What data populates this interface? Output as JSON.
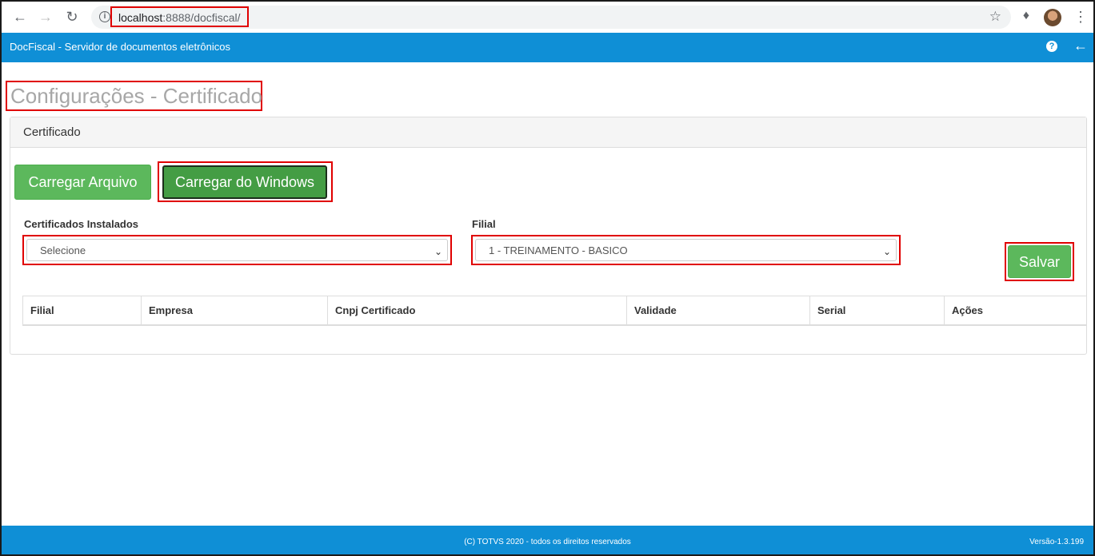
{
  "browser": {
    "url_host": "localhost",
    "url_path": ":8888/docfiscal/"
  },
  "app": {
    "title": "DocFiscal - Servidor de documentos eletrônicos"
  },
  "page": {
    "title": "Configurações - Certificado"
  },
  "panel": {
    "heading": "Certificado",
    "load_file_label": "Carregar Arquivo",
    "load_windows_label": "Carregar do Windows",
    "installed_label": "Certificados Instalados",
    "installed_value": "Selecione",
    "branch_label": "Filial",
    "branch_value": "1 - TREINAMENTO - BASICO",
    "save_label": "Salvar"
  },
  "table": {
    "columns": [
      "Filial",
      "Empresa",
      "Cnpj Certificado",
      "Validade",
      "Serial",
      "Ações"
    ]
  },
  "footer": {
    "copyright": "(C) TOTVS 2020 - todos os direitos reservados",
    "version": "Versão-1.3.199"
  },
  "colors": {
    "brand_blue": "#0f8fd6",
    "success_green": "#5cb85c",
    "highlight_red": "#e00000"
  }
}
